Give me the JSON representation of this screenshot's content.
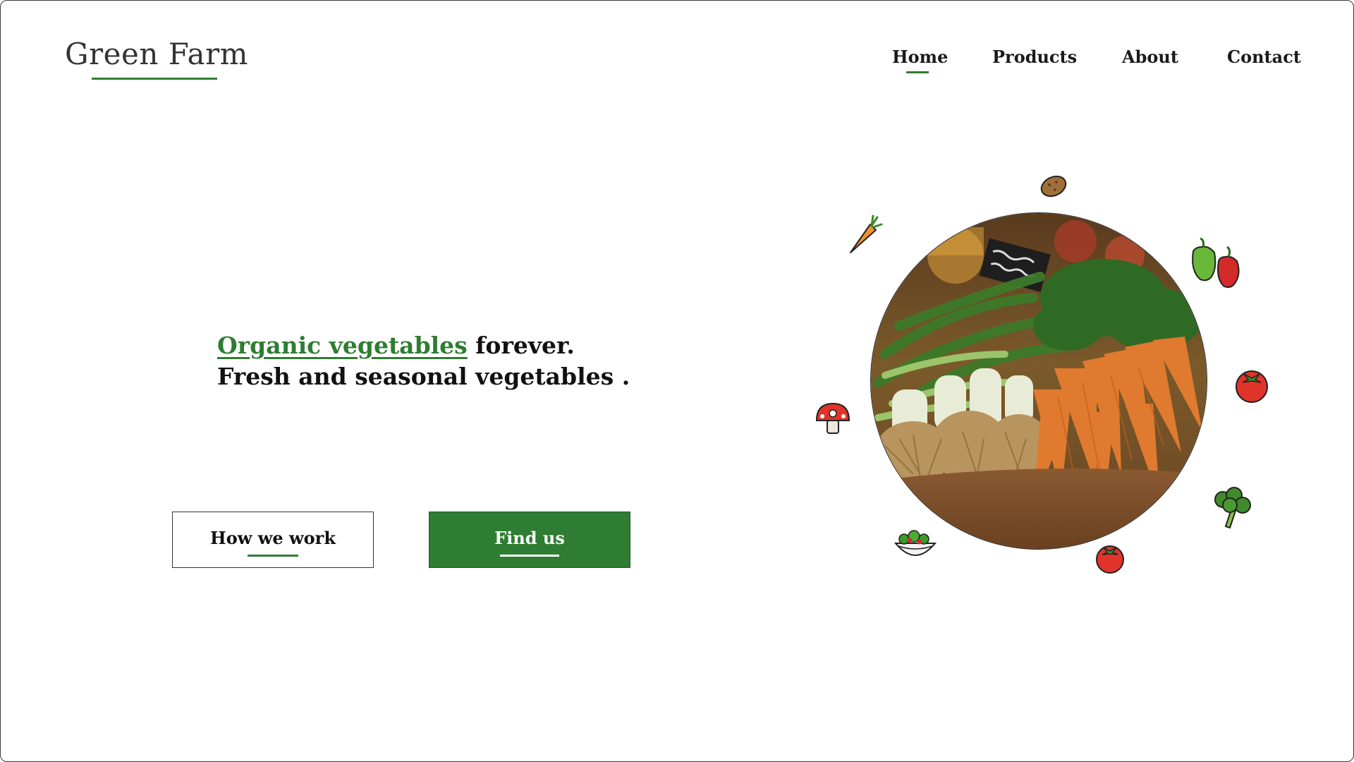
{
  "brand": {
    "name": "Green Farm",
    "accent_color": "#2e7d32"
  },
  "nav": {
    "items": [
      {
        "label": "Home",
        "active": true
      },
      {
        "label": "Products",
        "active": false
      },
      {
        "label": "About",
        "active": false
      },
      {
        "label": "Contact",
        "active": false
      }
    ]
  },
  "hero": {
    "headline_accent": "Organic vegetables",
    "headline_rest": " forever.",
    "subline": "Fresh and seasonal vegetables ."
  },
  "buttons": {
    "how_label": "How we work",
    "find_label": "Find us"
  },
  "illustration": {
    "photo_subject": "vegetable-market-photo",
    "icons": [
      "potato-icon",
      "carrot-icon",
      "pepper-icon",
      "tomato-icon",
      "mushroom-icon",
      "broccoli-icon",
      "salad-bowl-icon",
      "small-tomato-icon"
    ]
  }
}
